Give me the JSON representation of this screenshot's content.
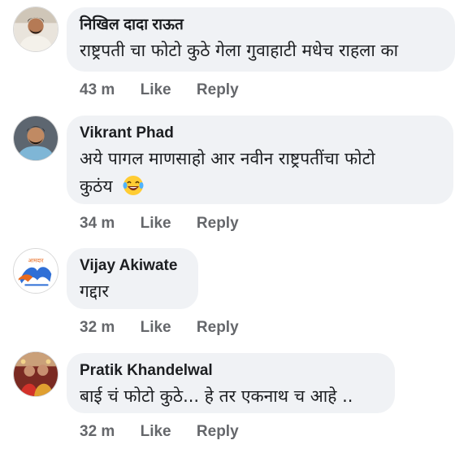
{
  "comments": [
    {
      "author": "निखिल दादा राऊत",
      "text": "राष्ट्रपती चा फोटो कुठे गेला गुवाहाटी मधेच राहला का",
      "time": "43 m",
      "like": "Like",
      "reply": "Reply"
    },
    {
      "author": "Vikrant Phad",
      "text": "अये पागल माणसाहो आर नवीन राष्ट्रपतींचा फोटो",
      "text_line2": "कुठंय",
      "emoji": "laughing-tears-emoji",
      "time": "34 m",
      "like": "Like",
      "reply": "Reply"
    },
    {
      "author": "Vijay Akiwate",
      "text": "गद्दार",
      "time": "32 m",
      "like": "Like",
      "reply": "Reply",
      "avatar_logo_text": "आमदार"
    },
    {
      "author": "Pratik Khandelwal",
      "text": "बाई चं फोटो कुठे... हे तर एकनाथ च आहे ..",
      "time": "32 m",
      "like": "Like",
      "reply": "Reply"
    }
  ],
  "colors": {
    "bubble": "#f0f2f5",
    "text": "#1c1e21",
    "meta": "#65676b"
  }
}
